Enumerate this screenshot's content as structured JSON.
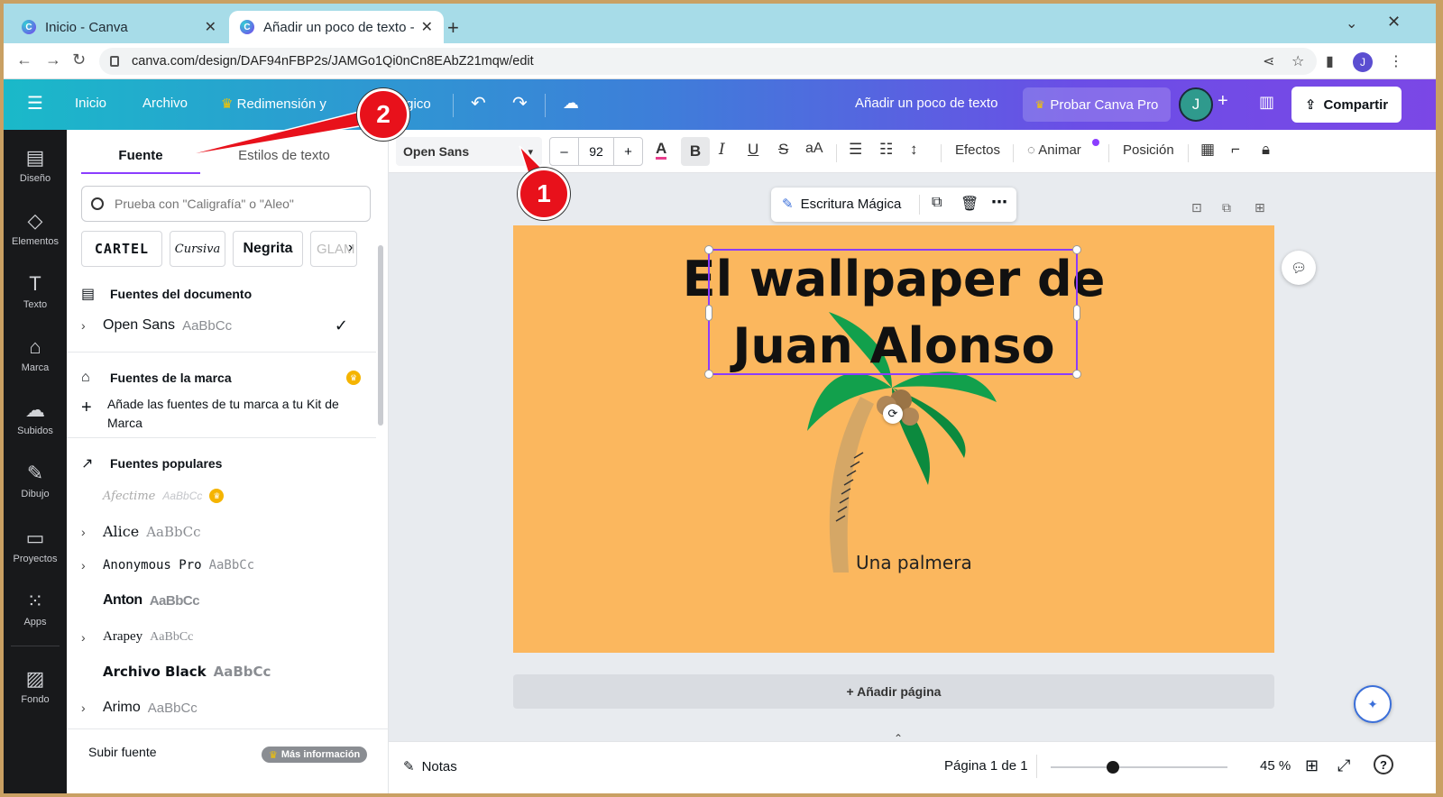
{
  "browser": {
    "tabs": [
      {
        "title": "Inicio - Canva"
      },
      {
        "title": "Añadir un poco de texto -"
      }
    ],
    "url": "canva.com/design/DAF94nFBP2s/JAMGo1Qi0nCn8EAbZ21mqw/edit",
    "profile_initial": "J"
  },
  "header": {
    "inicio": "Inicio",
    "archivo": "Archivo",
    "redimension": "Redimensión y",
    "magico": "ágico",
    "doc_title": "Añadir un poco de texto",
    "pro_button": "Probar Canva Pro",
    "avatar_initial": "J",
    "share_button": "Compartir"
  },
  "rail": {
    "items": [
      {
        "label": "Diseño",
        "icon": "layout-icon"
      },
      {
        "label": "Elementos",
        "icon": "shapes-icon"
      },
      {
        "label": "Texto",
        "icon": "text-icon"
      },
      {
        "label": "Marca",
        "icon": "brand-icon"
      },
      {
        "label": "Subidos",
        "icon": "cloud-upload-icon"
      },
      {
        "label": "Dibujo",
        "icon": "draw-icon"
      },
      {
        "label": "Proyectos",
        "icon": "folder-icon"
      },
      {
        "label": "Apps",
        "icon": "apps-grid-icon"
      },
      {
        "label": "Fondo",
        "icon": "background-icon"
      }
    ]
  },
  "panel": {
    "tab_font": "Fuente",
    "tab_styles": "Estilos de texto",
    "search_placeholder": "Prueba con \"Caligrafía\" o \"Aleo\"",
    "chips": [
      "CARTEL",
      "Cursiva",
      "Negrita",
      "GLAM"
    ],
    "doc_fonts_heading": "Fuentes del documento",
    "doc_font": {
      "name": "Open Sans",
      "sample": "AaBbCc"
    },
    "brand_heading": "Fuentes de la marca",
    "brand_add": "Añade las fuentes de tu marca a tu Kit de Marca",
    "popular_heading": "Fuentes populares",
    "popular_fonts": [
      {
        "name": "Afectime",
        "sample": "AaBbCc"
      },
      {
        "name": "Alice",
        "sample": "AaBbCc"
      },
      {
        "name": "Anonymous Pro",
        "sample": "AaBbCc"
      },
      {
        "name": "Anton",
        "sample": "AaBbCc"
      },
      {
        "name": "Arapey",
        "sample": "AaBbCc"
      },
      {
        "name": "Archivo Black",
        "sample": "AaBbCc"
      },
      {
        "name": "Arimo",
        "sample": "AaBbCc"
      }
    ],
    "upload_font": "Subir fuente",
    "more_info": "Más información"
  },
  "toolbar": {
    "font_name": "Open Sans",
    "font_size": "92",
    "minus": "–",
    "plus": "+",
    "effects": "Efectos",
    "animate": "Animar",
    "position": "Posición"
  },
  "canvas": {
    "magic_write": "Escritura Mágica",
    "title_line1": "El wallpaper de",
    "title_line2": "Juan Alonso",
    "caption": "Una palmera",
    "add_page": "+ Añadir página",
    "page_color": "#fbb75e"
  },
  "bottombar": {
    "notes": "Notas",
    "page_indicator": "Página 1 de 1",
    "zoom": "45 %",
    "zoom_level": 0.45
  },
  "annotations": [
    {
      "label": "1"
    },
    {
      "label": "2"
    }
  ],
  "colors": {
    "accent": "#8b3dff",
    "annotation_red": "#e8111b"
  }
}
